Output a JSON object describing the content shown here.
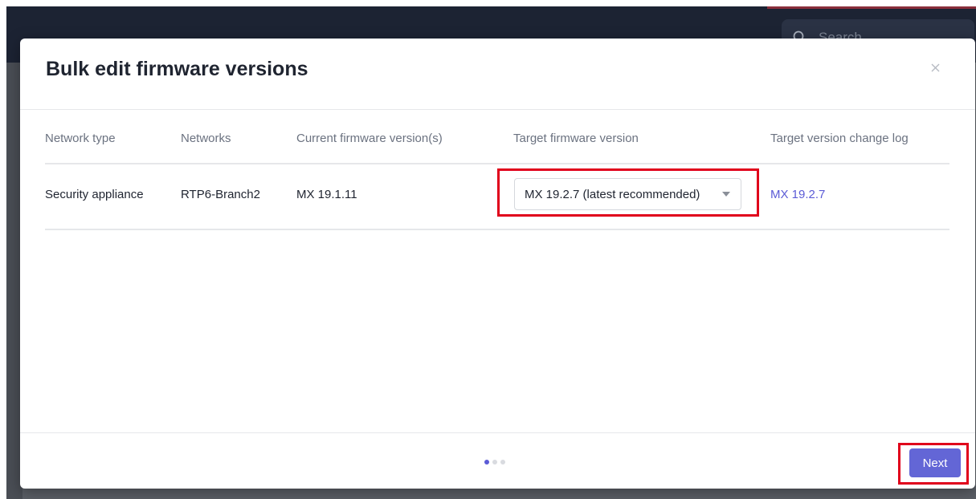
{
  "background": {
    "search_placeholder": "Search"
  },
  "modal": {
    "title": "Bulk edit firmware versions",
    "close_label": "×"
  },
  "table": {
    "columns": [
      "Network type",
      "Networks",
      "Current firmware version(s)",
      "Target firmware version",
      "Target version change log"
    ],
    "rows": [
      {
        "network_type": "Security appliance",
        "networks": "RTP6-Branch2",
        "current_version": "MX 19.1.11",
        "target_version": "MX 19.2.7 (latest recommended)",
        "change_log": "MX 19.2.7"
      }
    ]
  },
  "footer": {
    "page_current": 1,
    "page_total": 3,
    "next_label": "Next"
  },
  "colors": {
    "accent": "#6366d6",
    "link": "#5b5bd6",
    "highlight": "#e0001b"
  }
}
